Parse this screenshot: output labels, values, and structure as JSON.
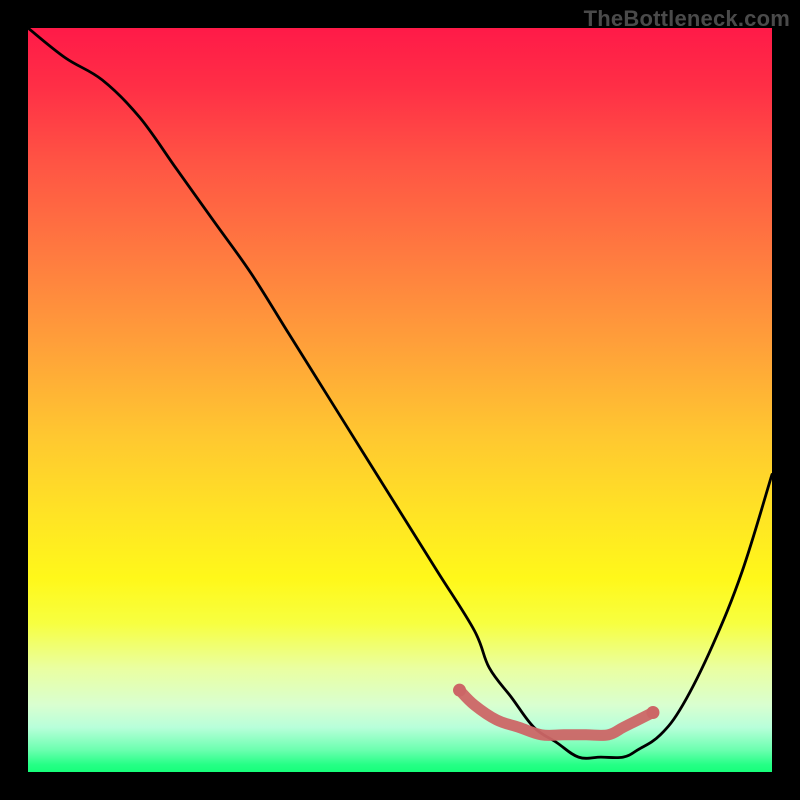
{
  "watermark": "TheBottleneck.com",
  "chart_data": {
    "type": "line",
    "title": "",
    "xlabel": "",
    "ylabel": "",
    "xlim": [
      0,
      100
    ],
    "ylim": [
      0,
      100
    ],
    "series": [
      {
        "name": "main-curve",
        "x": [
          0,
          5,
          10,
          15,
          20,
          25,
          30,
          35,
          40,
          45,
          50,
          55,
          60,
          62,
          65,
          68,
          71,
          74,
          77,
          80,
          82,
          85,
          88,
          92,
          96,
          100
        ],
        "values": [
          100,
          96,
          93,
          88,
          81,
          74,
          67,
          59,
          51,
          43,
          35,
          27,
          19,
          14,
          10,
          6,
          4,
          2,
          2,
          2,
          3,
          5,
          9,
          17,
          27,
          40
        ]
      },
      {
        "name": "highlight-band",
        "x": [
          58,
          60,
          63,
          66,
          69,
          72,
          75,
          78,
          80,
          82,
          84
        ],
        "values": [
          11,
          9,
          7,
          6,
          5,
          5,
          5,
          5,
          6,
          7,
          8
        ]
      }
    ],
    "gradient_stops": [
      {
        "pos": 0,
        "color": "#ff1a48"
      },
      {
        "pos": 8,
        "color": "#ff2f46"
      },
      {
        "pos": 18,
        "color": "#ff5444"
      },
      {
        "pos": 30,
        "color": "#ff7940"
      },
      {
        "pos": 42,
        "color": "#ff9e3a"
      },
      {
        "pos": 55,
        "color": "#ffc830"
      },
      {
        "pos": 66,
        "color": "#ffe524"
      },
      {
        "pos": 74,
        "color": "#fff81a"
      },
      {
        "pos": 80,
        "color": "#f7ff40"
      },
      {
        "pos": 86,
        "color": "#eaffa0"
      },
      {
        "pos": 91,
        "color": "#d9ffd0"
      },
      {
        "pos": 94,
        "color": "#b8ffda"
      },
      {
        "pos": 97,
        "color": "#6dffb0"
      },
      {
        "pos": 99,
        "color": "#26ff86"
      },
      {
        "pos": 100,
        "color": "#16ff7a"
      }
    ],
    "colors": {
      "curve": "#000000",
      "highlight": "#cc6666",
      "background": "#000000"
    }
  }
}
